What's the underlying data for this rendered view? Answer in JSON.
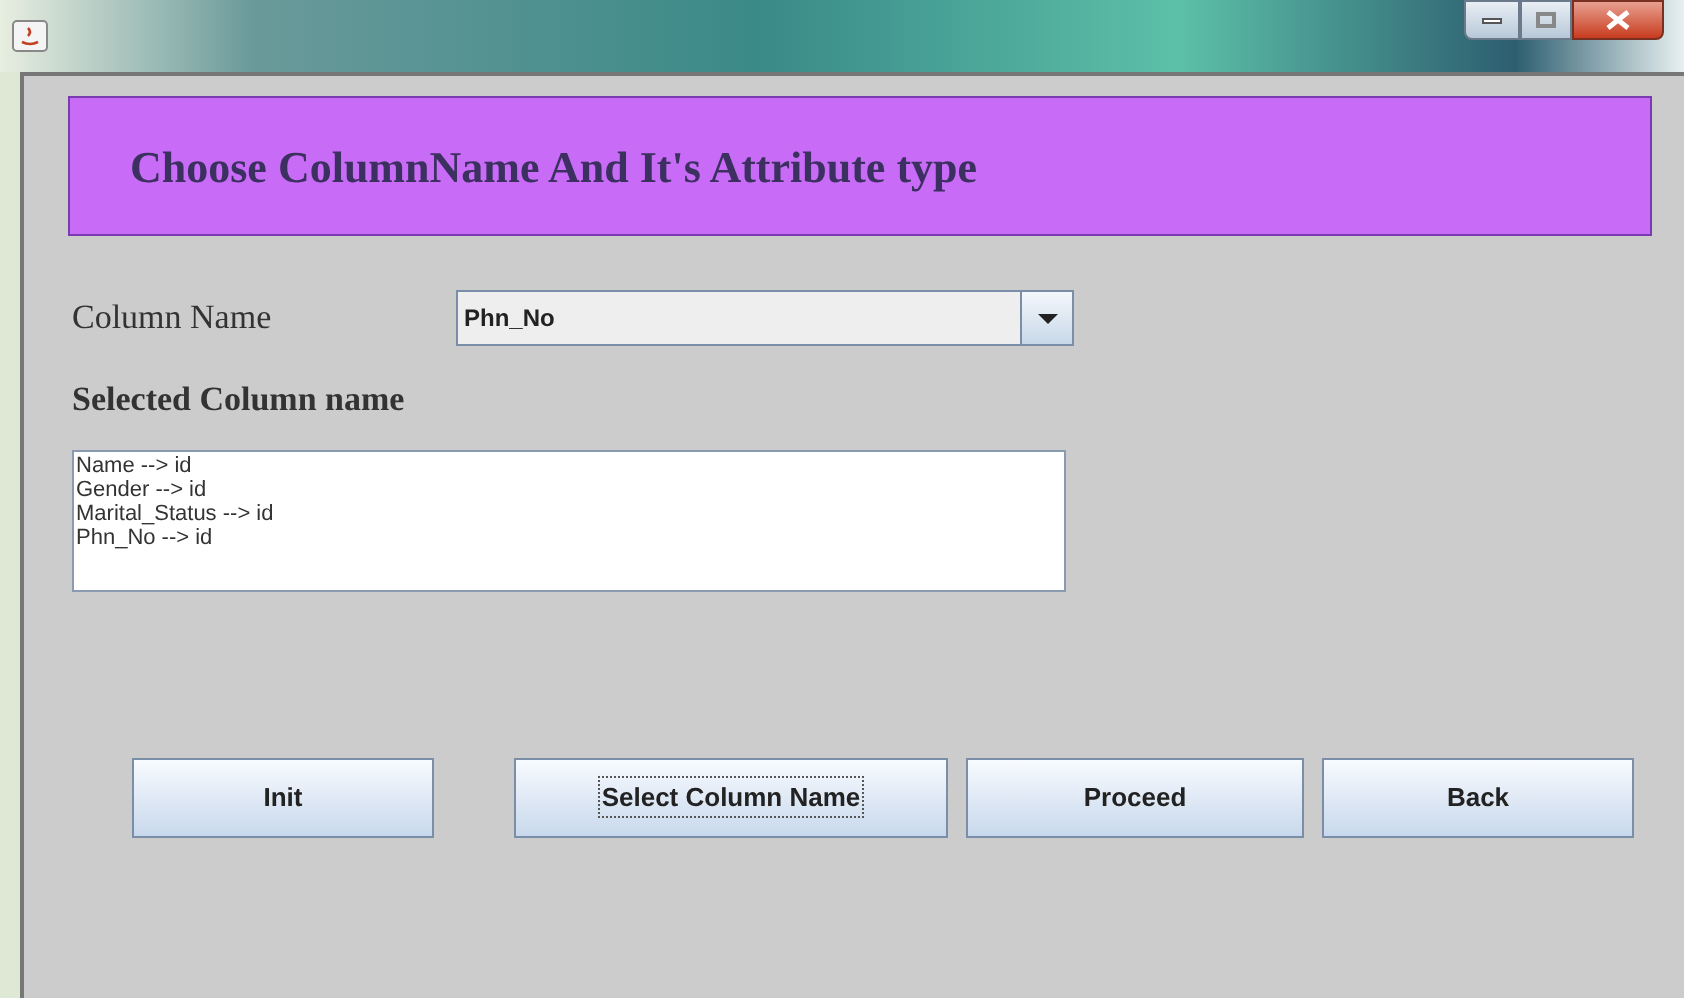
{
  "header": {
    "title": "Choose ColumnName And It's Attribute type"
  },
  "column_name": {
    "label": "Column Name",
    "value": "Phn_No"
  },
  "selected_section": {
    "label": "Selected Column name",
    "lines": [
      "Name --> id",
      "Gender --> id",
      "Marital_Status --> id",
      "Phn_No --> id"
    ]
  },
  "buttons": [
    {
      "label": "Init",
      "focused": false
    },
    {
      "label": "Select Column Name",
      "focused": true
    },
    {
      "label": "Proceed",
      "focused": false
    },
    {
      "label": "Back",
      "focused": false
    }
  ]
}
